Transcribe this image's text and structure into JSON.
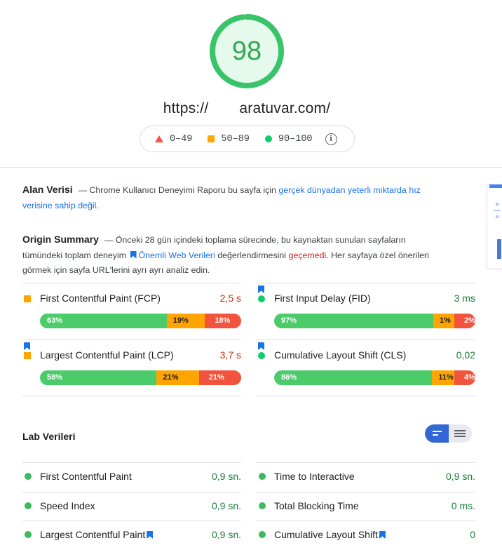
{
  "header": {
    "score": "98",
    "score_color": "#0cce6b",
    "url": "https://          aratuvar.com/",
    "legend": [
      {
        "icon": "triangle-icon",
        "label": "0–49",
        "color": "#ff4e42"
      },
      {
        "icon": "square-icon",
        "label": "50–89",
        "color": "#ffa400"
      },
      {
        "icon": "circle-icon",
        "label": "90–100",
        "color": "#0cce6b"
      }
    ],
    "info_icon": "ⓘ"
  },
  "field": {
    "heading": "Alan Verisi",
    "text": "— Chrome Kullanıcı Deneyimi Raporu bu sayfa için ",
    "link": "gerçek dünyadan yeterli miktarda hız verisine sahip değil",
    "end": "."
  },
  "origin": {
    "heading": "Origin Summary",
    "text1": "— Önceki 28 gün içindeki toplama sürecinde, bu kaynaktan sunulan sayfaların tümündeki toplam deneyim ",
    "link": "Önemli Web Verileri",
    "text2": " değerlendirmesini ",
    "fail": "geçemedi",
    "text3": ". Her sayfaya özel önerileri görmek için sayfa URL'lerini ayrı ayrı analiz edin.",
    "metrics": [
      {
        "title": "First Contentful Paint (FCP)",
        "value": "2,5 s",
        "rating": "average",
        "bookmark": false,
        "dist": [
          63,
          19,
          18
        ],
        "labels": [
          "63%",
          "19%",
          "18%"
        ]
      },
      {
        "title": "First Input Delay (FID)",
        "value": "3 ms",
        "rating": "good",
        "bookmark": true,
        "dist": [
          97,
          1,
          2
        ],
        "labels": [
          "97%",
          "1%",
          "2%"
        ]
      },
      {
        "title": "Largest Contentful Paint (LCP)",
        "value": "3,7 s",
        "rating": "average",
        "bookmark": true,
        "dist": [
          58,
          21,
          21
        ],
        "labels": [
          "58%",
          "21%",
          "21%"
        ]
      },
      {
        "title": "Cumulative Layout Shift (CLS)",
        "value": "0,02",
        "rating": "good",
        "bookmark": true,
        "dist": [
          86,
          11,
          4
        ],
        "labels": [
          "86%",
          "11%",
          "4%"
        ]
      }
    ]
  },
  "lab": {
    "heading": "Lab Verileri",
    "metrics": [
      {
        "title": "First Contentful Paint",
        "value": "0,9 sn.",
        "bookmark": false
      },
      {
        "title": "Time to Interactive",
        "value": "0,9 sn.",
        "bookmark": false
      },
      {
        "title": "Speed Index",
        "value": "0,9 sn.",
        "bookmark": false
      },
      {
        "title": "Total Blocking Time",
        "value": "0 ms.",
        "bookmark": false
      },
      {
        "title": "Largest Contentful Paint",
        "value": "0,9 sn.",
        "bookmark": true
      },
      {
        "title": "Cumulative Layout Shift",
        "value": "0",
        "bookmark": true
      }
    ]
  },
  "colors": {
    "good": "#0cce6b",
    "average": "#ffa400",
    "poor": "#ff4e42",
    "link": "#1a73e8"
  }
}
